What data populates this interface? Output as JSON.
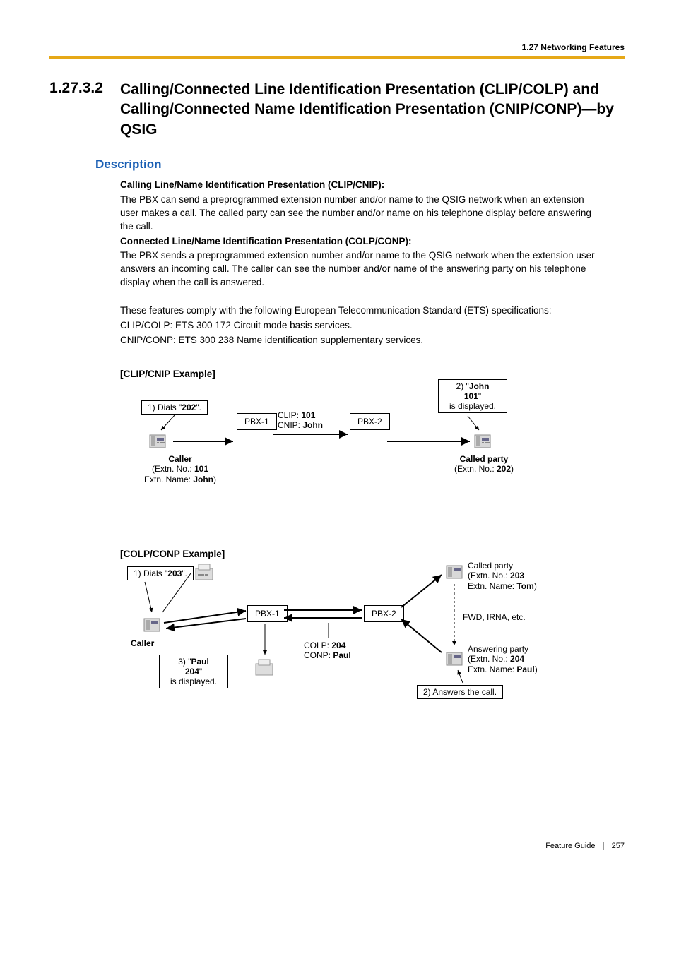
{
  "header": {
    "breadcrumb": "1.27 Networking Features"
  },
  "section": {
    "number": "1.27.3.2",
    "title": "Calling/Connected Line Identification Presentation (CLIP/COLP) and Calling/Connected Name Identification Presentation (CNIP/CONP)—by QSIG"
  },
  "description": {
    "heading": "Description",
    "clip_title": "Calling Line/Name Identification Presentation (CLIP/CNIP):",
    "clip_text": "The PBX can send a preprogrammed extension number and/or name to the QSIG network when an extension user makes a call. The called party can see the number and/or name on his telephone display before answering the call.",
    "colp_title": "Connected Line/Name Identification Presentation (COLP/CONP):",
    "colp_text": "The PBX sends a preprogrammed extension number and/or name to the QSIG network when the extension user answers an incoming call. The caller can see the number and/or name of the answering party on his telephone display when the call is answered.",
    "compliance": "These features comply with the following European Telecommunication Standard (ETS) specifications:",
    "spec1": "CLIP/COLP: ETS 300 172 Circuit mode basis services.",
    "spec2": "CNIP/CONP: ETS 300 238 Name identification supplementary services."
  },
  "example1": {
    "heading": "[CLIP/CNIP Example]",
    "step1_prefix": "1) Dials \"",
    "step1_num": "202",
    "step1_suffix": "\".",
    "pbx1": "PBX-1",
    "pbx2": "PBX-2",
    "clip_label": "CLIP: ",
    "clip_val": "101",
    "cnip_label": "CNIP: ",
    "cnip_val": "John",
    "step2_a": "2) \"",
    "step2_name": "John",
    "step2_num": "101",
    "step2_b": "\"",
    "step2_c": "is displayed.",
    "caller_title": "Caller",
    "caller_ext_label": "(Extn. No.: ",
    "caller_ext_num": "101",
    "caller_name_label": "Extn. Name: ",
    "caller_name": "John",
    "caller_close": ")",
    "called_title": "Called party",
    "called_ext_label": "(Extn. No.: ",
    "called_ext_num": "202",
    "called_close": ")"
  },
  "example2": {
    "heading": "[COLP/CONP Example]",
    "step1_prefix": "1) Dials \"",
    "step1_num": "203",
    "step1_suffix": "\".",
    "pbx1": "PBX-1",
    "pbx2": "PBX-2",
    "colp_label": "COLP: ",
    "colp_val": "204",
    "conp_label": "CONP: ",
    "conp_val": "Paul",
    "caller_title": "Caller",
    "step3_a": "3) \"",
    "step3_name": "Paul",
    "step3_num": "204",
    "step3_b": "\"",
    "step3_c": "is displayed.",
    "called_label": "Called party",
    "called_ext_label": "(Extn. No.: ",
    "called_ext_num": "203",
    "called_name_label": "Extn. Name: ",
    "called_name": "Tom",
    "called_close": ")",
    "fwd": "FWD, IRNA, etc.",
    "answering_label": "Answering party",
    "answering_ext_label": "(Extn. No.: ",
    "answering_ext_num": "204",
    "answering_name_label": "Extn. Name: ",
    "answering_name": "Paul",
    "answering_close": ")",
    "step2": "2) Answers the call."
  },
  "footer": {
    "guide": "Feature Guide",
    "page": "257"
  }
}
